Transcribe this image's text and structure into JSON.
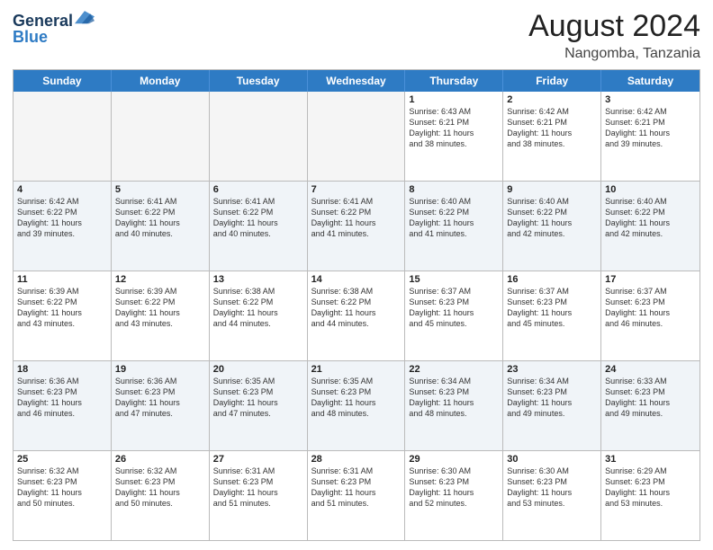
{
  "header": {
    "logo_line1": "General",
    "logo_line2": "Blue",
    "month_year": "August 2024",
    "location": "Nangomba, Tanzania"
  },
  "days_of_week": [
    "Sunday",
    "Monday",
    "Tuesday",
    "Wednesday",
    "Thursday",
    "Friday",
    "Saturday"
  ],
  "weeks": [
    [
      {
        "day": "",
        "info": ""
      },
      {
        "day": "",
        "info": ""
      },
      {
        "day": "",
        "info": ""
      },
      {
        "day": "",
        "info": ""
      },
      {
        "day": "1",
        "info": "Sunrise: 6:43 AM\nSunset: 6:21 PM\nDaylight: 11 hours\nand 38 minutes."
      },
      {
        "day": "2",
        "info": "Sunrise: 6:42 AM\nSunset: 6:21 PM\nDaylight: 11 hours\nand 38 minutes."
      },
      {
        "day": "3",
        "info": "Sunrise: 6:42 AM\nSunset: 6:21 PM\nDaylight: 11 hours\nand 39 minutes."
      }
    ],
    [
      {
        "day": "4",
        "info": "Sunrise: 6:42 AM\nSunset: 6:22 PM\nDaylight: 11 hours\nand 39 minutes."
      },
      {
        "day": "5",
        "info": "Sunrise: 6:41 AM\nSunset: 6:22 PM\nDaylight: 11 hours\nand 40 minutes."
      },
      {
        "day": "6",
        "info": "Sunrise: 6:41 AM\nSunset: 6:22 PM\nDaylight: 11 hours\nand 40 minutes."
      },
      {
        "day": "7",
        "info": "Sunrise: 6:41 AM\nSunset: 6:22 PM\nDaylight: 11 hours\nand 41 minutes."
      },
      {
        "day": "8",
        "info": "Sunrise: 6:40 AM\nSunset: 6:22 PM\nDaylight: 11 hours\nand 41 minutes."
      },
      {
        "day": "9",
        "info": "Sunrise: 6:40 AM\nSunset: 6:22 PM\nDaylight: 11 hours\nand 42 minutes."
      },
      {
        "day": "10",
        "info": "Sunrise: 6:40 AM\nSunset: 6:22 PM\nDaylight: 11 hours\nand 42 minutes."
      }
    ],
    [
      {
        "day": "11",
        "info": "Sunrise: 6:39 AM\nSunset: 6:22 PM\nDaylight: 11 hours\nand 43 minutes."
      },
      {
        "day": "12",
        "info": "Sunrise: 6:39 AM\nSunset: 6:22 PM\nDaylight: 11 hours\nand 43 minutes."
      },
      {
        "day": "13",
        "info": "Sunrise: 6:38 AM\nSunset: 6:22 PM\nDaylight: 11 hours\nand 44 minutes."
      },
      {
        "day": "14",
        "info": "Sunrise: 6:38 AM\nSunset: 6:22 PM\nDaylight: 11 hours\nand 44 minutes."
      },
      {
        "day": "15",
        "info": "Sunrise: 6:37 AM\nSunset: 6:23 PM\nDaylight: 11 hours\nand 45 minutes."
      },
      {
        "day": "16",
        "info": "Sunrise: 6:37 AM\nSunset: 6:23 PM\nDaylight: 11 hours\nand 45 minutes."
      },
      {
        "day": "17",
        "info": "Sunrise: 6:37 AM\nSunset: 6:23 PM\nDaylight: 11 hours\nand 46 minutes."
      }
    ],
    [
      {
        "day": "18",
        "info": "Sunrise: 6:36 AM\nSunset: 6:23 PM\nDaylight: 11 hours\nand 46 minutes."
      },
      {
        "day": "19",
        "info": "Sunrise: 6:36 AM\nSunset: 6:23 PM\nDaylight: 11 hours\nand 47 minutes."
      },
      {
        "day": "20",
        "info": "Sunrise: 6:35 AM\nSunset: 6:23 PM\nDaylight: 11 hours\nand 47 minutes."
      },
      {
        "day": "21",
        "info": "Sunrise: 6:35 AM\nSunset: 6:23 PM\nDaylight: 11 hours\nand 48 minutes."
      },
      {
        "day": "22",
        "info": "Sunrise: 6:34 AM\nSunset: 6:23 PM\nDaylight: 11 hours\nand 48 minutes."
      },
      {
        "day": "23",
        "info": "Sunrise: 6:34 AM\nSunset: 6:23 PM\nDaylight: 11 hours\nand 49 minutes."
      },
      {
        "day": "24",
        "info": "Sunrise: 6:33 AM\nSunset: 6:23 PM\nDaylight: 11 hours\nand 49 minutes."
      }
    ],
    [
      {
        "day": "25",
        "info": "Sunrise: 6:32 AM\nSunset: 6:23 PM\nDaylight: 11 hours\nand 50 minutes."
      },
      {
        "day": "26",
        "info": "Sunrise: 6:32 AM\nSunset: 6:23 PM\nDaylight: 11 hours\nand 50 minutes."
      },
      {
        "day": "27",
        "info": "Sunrise: 6:31 AM\nSunset: 6:23 PM\nDaylight: 11 hours\nand 51 minutes."
      },
      {
        "day": "28",
        "info": "Sunrise: 6:31 AM\nSunset: 6:23 PM\nDaylight: 11 hours\nand 51 minutes."
      },
      {
        "day": "29",
        "info": "Sunrise: 6:30 AM\nSunset: 6:23 PM\nDaylight: 11 hours\nand 52 minutes."
      },
      {
        "day": "30",
        "info": "Sunrise: 6:30 AM\nSunset: 6:23 PM\nDaylight: 11 hours\nand 53 minutes."
      },
      {
        "day": "31",
        "info": "Sunrise: 6:29 AM\nSunset: 6:23 PM\nDaylight: 11 hours\nand 53 minutes."
      }
    ]
  ]
}
